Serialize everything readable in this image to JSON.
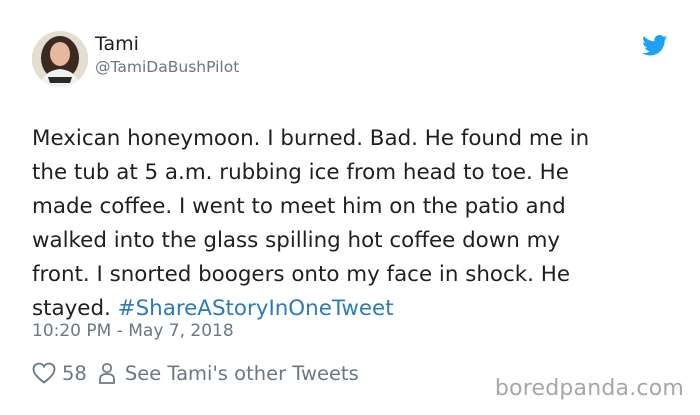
{
  "author": {
    "name": "Tami",
    "handle": "@TamiDaBushPilot"
  },
  "tweet": {
    "lines": [
      "Mexican honeymoon. I burned. Bad. He found me in",
      "the tub at 5 a.m. rubbing ice from head to toe. He",
      "made coffee. I went to meet him on the patio and",
      "walked into the glass spilling hot coffee down my",
      "front. I snorted boogers onto my face in shock. He",
      "stayed."
    ],
    "hashtag": "#ShareAStoryInOneTweet",
    "timestamp": "10:20 PM - May 7, 2018"
  },
  "actions": {
    "like_count": "58",
    "other_tweets_label": "See Tami's other Tweets"
  },
  "watermark": "boredpanda.com",
  "icons": {
    "brand": "twitter-bird-icon",
    "like": "heart-icon",
    "profile": "person-icon"
  },
  "colors": {
    "twitter_blue": "#1da1f2",
    "hashtag": "#2b7bb9",
    "muted_text": "#697882",
    "primary_text": "#1c2022",
    "watermark": "#a7a7a7"
  }
}
